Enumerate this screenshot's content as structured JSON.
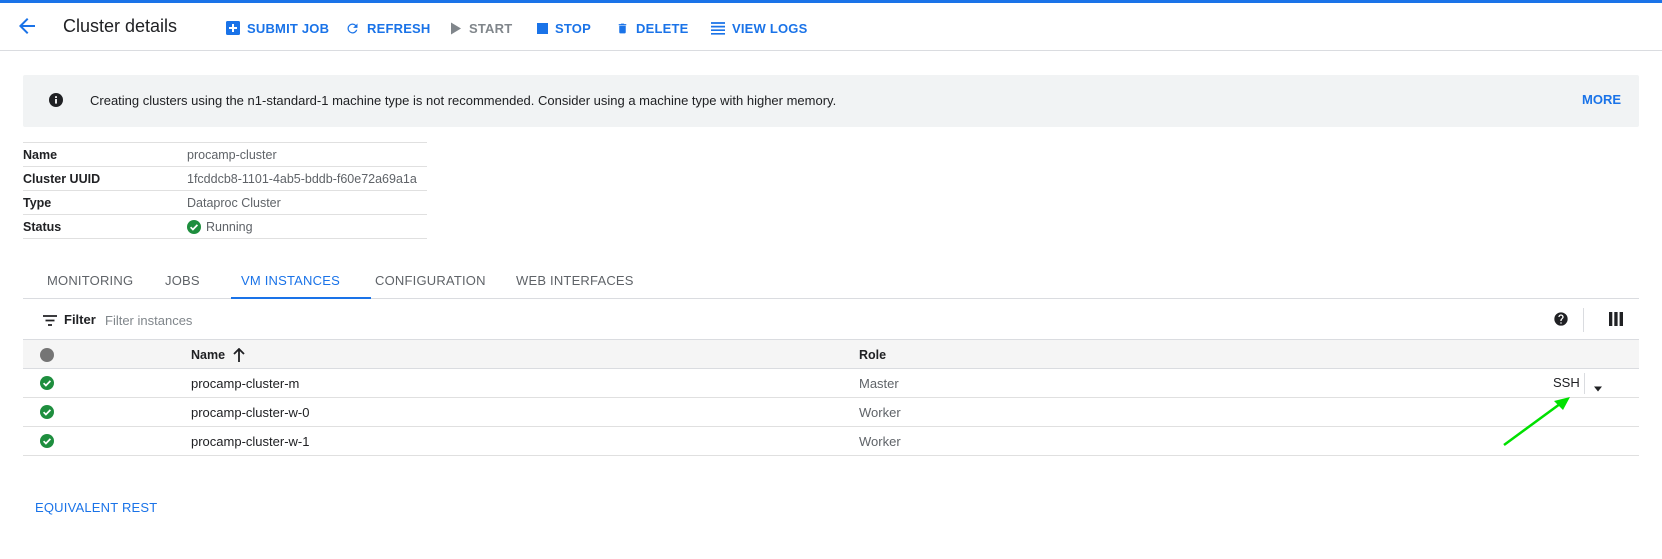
{
  "header": {
    "title": "Cluster details",
    "actions": {
      "submit_job": "SUBMIT JOB",
      "refresh": "REFRESH",
      "start": "START",
      "stop": "STOP",
      "delete": "DELETE",
      "view_logs": "VIEW LOGS"
    }
  },
  "banner": {
    "message": "Creating clusters using the n1-standard-1 machine type is not recommended. Consider using a machine type with higher memory.",
    "more": "MORE"
  },
  "properties": [
    {
      "key": "Name",
      "value": "procamp-cluster"
    },
    {
      "key": "Cluster UUID",
      "value": "1fcddcb8-1101-4ab5-bddb-f60e72a69a1a"
    },
    {
      "key": "Type",
      "value": "Dataproc Cluster"
    },
    {
      "key": "Status",
      "value": "Running"
    }
  ],
  "tabs": [
    "MONITORING",
    "JOBS",
    "VM INSTANCES",
    "CONFIGURATION",
    "WEB INTERFACES"
  ],
  "active_tab": "VM INSTANCES",
  "filter": {
    "label": "Filter",
    "placeholder": "Filter instances"
  },
  "table": {
    "columns": {
      "name": "Name",
      "role": "Role"
    },
    "rows": [
      {
        "name": "procamp-cluster-m",
        "role": "Master",
        "action": "SSH"
      },
      {
        "name": "procamp-cluster-w-0",
        "role": "Worker"
      },
      {
        "name": "procamp-cluster-w-1",
        "role": "Worker"
      }
    ]
  },
  "footer": {
    "equivalent_rest": "EQUIVALENT REST"
  },
  "colors": {
    "accent": "#1a73e8",
    "success": "#1e8e3e",
    "annotation_arrow": "#00e000"
  }
}
